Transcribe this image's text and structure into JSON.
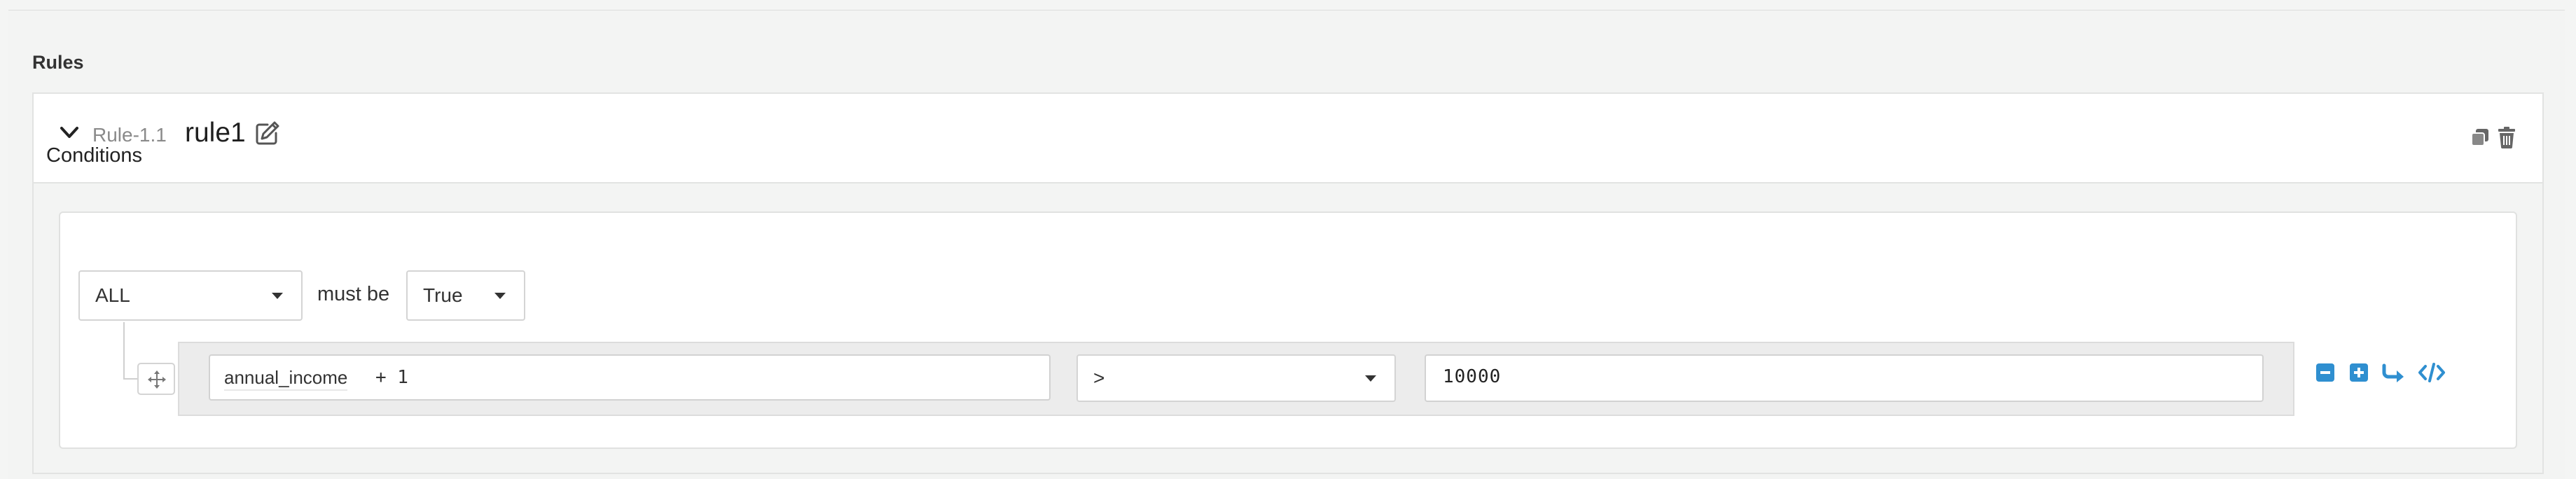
{
  "section": {
    "title": "Rules"
  },
  "rule": {
    "id": "Rule-1.1",
    "name": "rule1"
  },
  "conditions": {
    "title": "Conditions",
    "quantifier": "ALL",
    "must_be_label": "must be",
    "truth_value": "True",
    "row": {
      "field": "annual_income",
      "expression_suffix": "+ 1",
      "operator": ">",
      "value": "10000"
    }
  },
  "icons": {
    "collapse": "chevron-down-icon",
    "edit": "edit-icon",
    "copy": "copy-icon",
    "delete": "trash-icon",
    "drag": "move-icon",
    "remove_condition": "minus-square-icon",
    "add_condition": "plus-square-icon",
    "add_group": "share-arrow-icon",
    "code_view": "code-icon"
  },
  "colors": {
    "accent": "#2f8fd0",
    "muted_icon": "#555555"
  }
}
